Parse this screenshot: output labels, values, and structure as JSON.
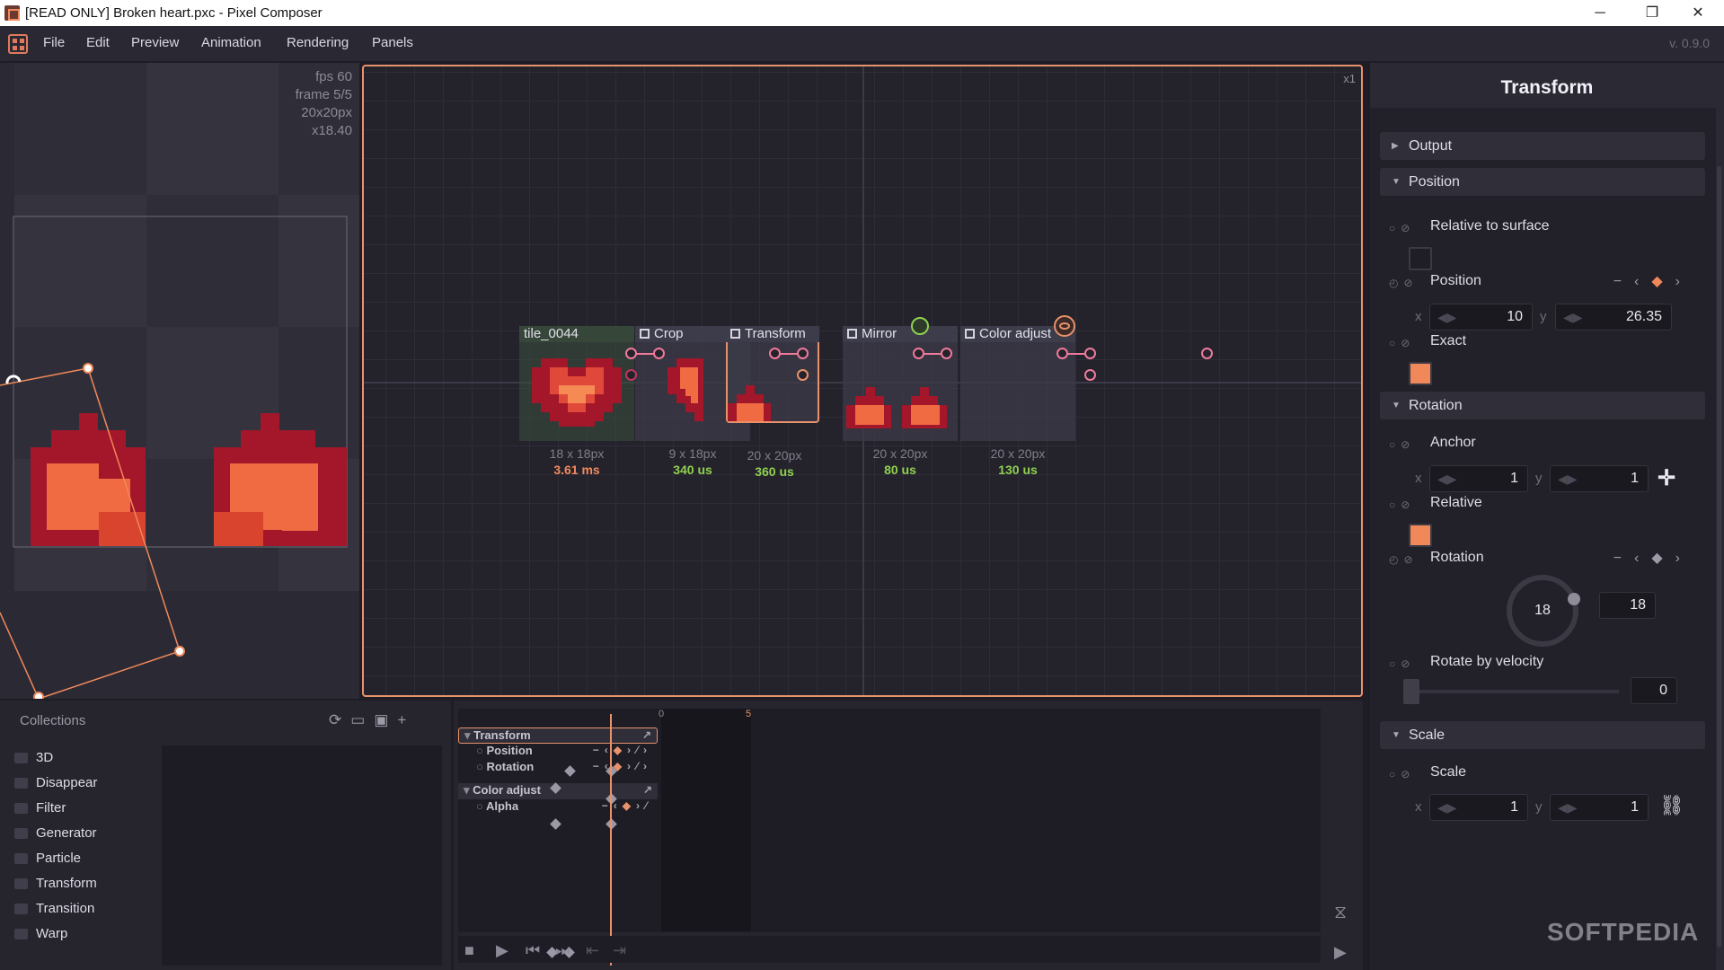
{
  "window": {
    "title": "[READ ONLY] Broken heart.pxc - Pixel Composer",
    "minimize": "─",
    "maximize": "❐",
    "close": "✕"
  },
  "menu": {
    "items": [
      "File",
      "Edit",
      "Preview",
      "Animation",
      "Rendering",
      "Panels"
    ],
    "version": "v. 0.9.0"
  },
  "preview": {
    "fps": "fps 60",
    "frame": "frame 5/5",
    "size": "20x20px",
    "zoom": "x18.40"
  },
  "graph": {
    "zoom": "x1",
    "nodes": [
      {
        "name": "tile_0044",
        "dims": "18 x 18px",
        "time": "3.61 ms",
        "time_color": "#f08a5d"
      },
      {
        "name": "Crop",
        "dims": "9 x 18px",
        "time": "340 us",
        "time_color": "#8fd14f"
      },
      {
        "name": "Transform",
        "dims": "20 x 20px",
        "time": "360 us",
        "time_color": "#8fd14f"
      },
      {
        "name": "Mirror",
        "dims": "20 x 20px",
        "time": "80 us",
        "time_color": "#8fd14f"
      },
      {
        "name": "Color adjust",
        "dims": "20 x 20px",
        "time": "130 us",
        "time_color": "#8fd14f"
      }
    ]
  },
  "collections": {
    "title": "Collections",
    "items": [
      "3D",
      "Disappear",
      "Filter",
      "Generator",
      "Particle",
      "Transform",
      "Transition",
      "Warp"
    ]
  },
  "timeline": {
    "groups": [
      {
        "name": "Transform",
        "props": [
          "Position",
          "Rotation"
        ]
      },
      {
        "name": "Color adjust",
        "props": [
          "Alpha"
        ]
      }
    ],
    "frame_marker": "5",
    "start": "0"
  },
  "inspector": {
    "title": "Transform",
    "sections": {
      "output": "Output",
      "position": "Position",
      "rotation": "Rotation",
      "scale": "Scale"
    },
    "props": {
      "relative_to_surface": "Relative to surface",
      "position": "Position",
      "exact": "Exact",
      "anchor": "Anchor",
      "relative": "Relative",
      "rotation": "Rotation",
      "rotate_by_velocity": "Rotate by velocity",
      "scale": "Scale"
    },
    "values": {
      "pos_x": "10",
      "pos_y": "26.35",
      "anchor_x": "1",
      "anchor_y": "1",
      "rotation": "18",
      "rotation_field": "18",
      "rotate_velocity": "0",
      "scale_x": "1",
      "scale_y": "1"
    },
    "axis": {
      "x": "x",
      "y": "y"
    },
    "accent": "#f0885a"
  },
  "watermark": "SOFTPEDIA"
}
